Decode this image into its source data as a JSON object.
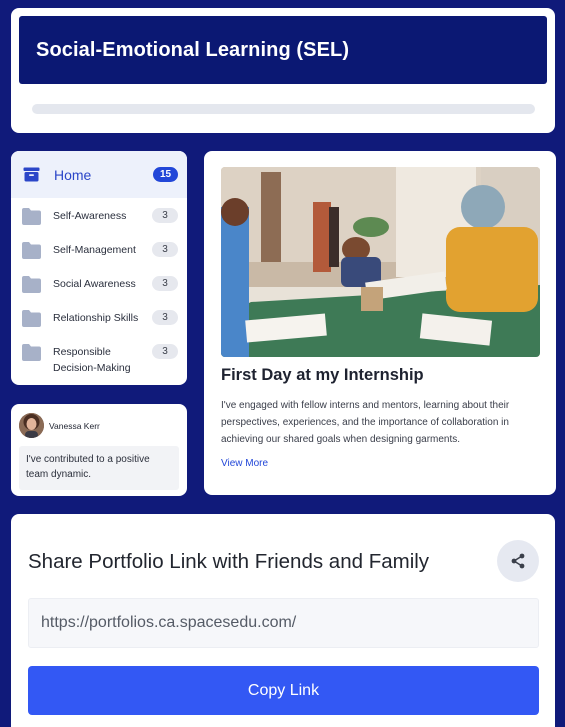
{
  "header": {
    "title": "Social-Emotional Learning (SEL)",
    "progress": 0
  },
  "sidebar": {
    "home": {
      "label": "Home",
      "count": "15",
      "icon": "inbox-icon"
    },
    "items": [
      {
        "label": "Self-Awareness",
        "count": "3",
        "icon": "folder-icon"
      },
      {
        "label": "Self-Management",
        "count": "3",
        "icon": "folder-icon"
      },
      {
        "label": "Social Awareness",
        "count": "3",
        "icon": "folder-icon"
      },
      {
        "label": "Relationship Skills",
        "count": "3",
        "icon": "folder-icon"
      },
      {
        "label": "Responsible Decision-Making",
        "count": "3",
        "icon": "folder-icon"
      }
    ]
  },
  "comment": {
    "author": "Vanessa Kerr",
    "text": "I've contributed to a positive team dynamic."
  },
  "post": {
    "title": "First Day at my Internship",
    "body": "I've engaged with fellow interns and mentors, learning about their perspectives, experiences, and the importance of collaboration in achieving our shared goals when designing garments.",
    "view_more": "View More"
  },
  "share": {
    "title": "Share Portfolio Link with Friends and Family",
    "link": "https://portfolios.ca.spacesedu.com/",
    "copy_label": "Copy Link",
    "icon": "share-icon"
  },
  "colors": {
    "background": "#101a7a",
    "header": "#0b1873",
    "accent": "#2247d8",
    "button": "#3358f4"
  }
}
